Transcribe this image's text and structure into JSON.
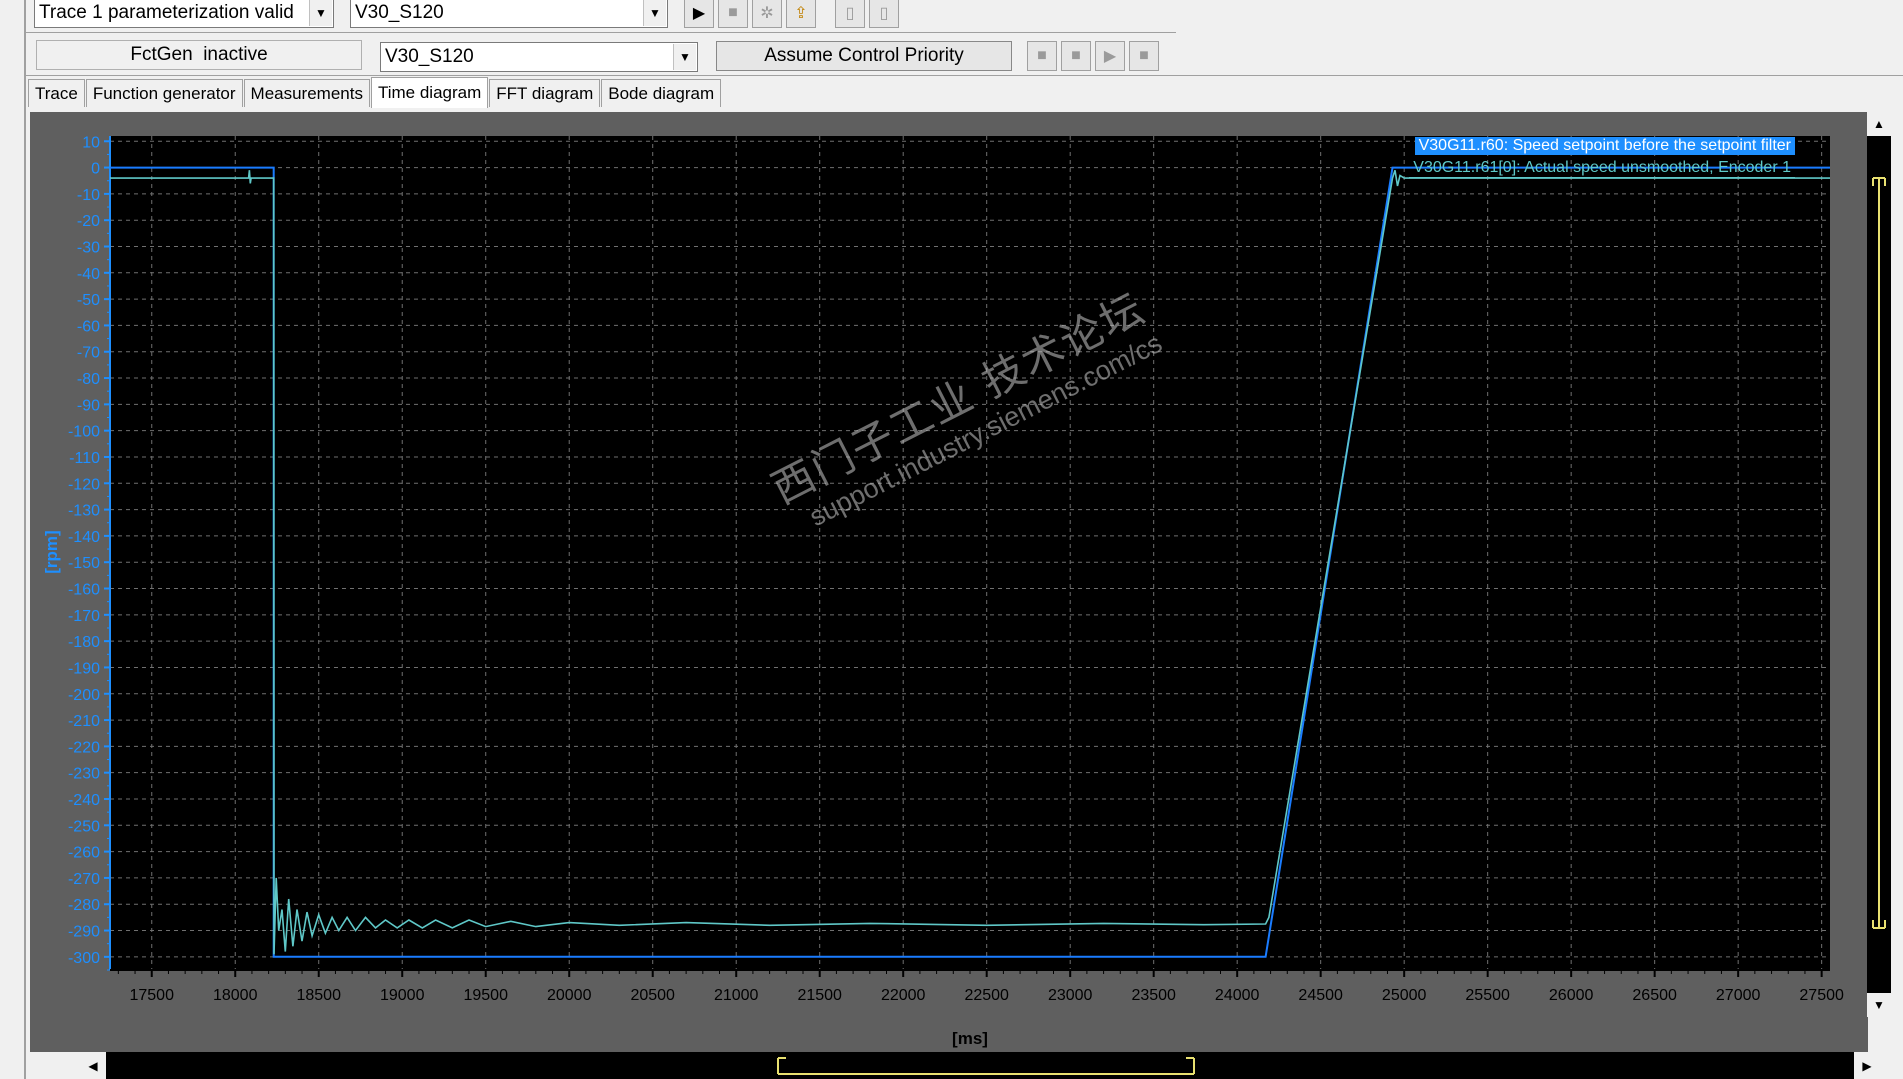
{
  "toolbar": {
    "trace_status": "Trace 1 parameterization valid",
    "device_select_1": "V30_S120",
    "fctgen_status": "FctGen  inactive",
    "device_select_2": "V30_S120",
    "assume_control_priority_label": "Assume Control Priority"
  },
  "tabs": [
    {
      "label": "Trace"
    },
    {
      "label": "Function generator"
    },
    {
      "label": "Measurements"
    },
    {
      "label": "Time diagram"
    },
    {
      "label": "FFT diagram"
    },
    {
      "label": "Bode diagram"
    }
  ],
  "active_tab": "Time diagram",
  "watermark": {
    "line1": "西门子工业  技术论坛",
    "line2": "support.industry.siemens.com/cs"
  },
  "colors": {
    "plot_background": "#000000",
    "panel_background": "#5f5f5f",
    "axis_color": "#1e8fff",
    "setpoint_color": "#1a7cff",
    "actual_color": "#5fc8c8",
    "grid_color": "#707070",
    "legend_highlight": "#1e8fff"
  },
  "chart_data": {
    "type": "line",
    "title": "",
    "xlabel": "[ms]",
    "ylabel": "[rpm]",
    "xlim": [
      17250,
      27550
    ],
    "ylim": [
      -305,
      12
    ],
    "x_ticks": [
      17500,
      18000,
      18500,
      19000,
      19500,
      20000,
      20500,
      21000,
      21500,
      22000,
      22500,
      23000,
      23500,
      24000,
      24500,
      25000,
      25500,
      26000,
      26500,
      27000,
      27500
    ],
    "y_ticks": [
      10,
      0,
      -10,
      -20,
      -30,
      -40,
      -50,
      -60,
      -70,
      -80,
      -90,
      -100,
      -110,
      -120,
      -130,
      -140,
      -150,
      -160,
      -170,
      -180,
      -190,
      -200,
      -210,
      -220,
      -230,
      -240,
      -250,
      -260,
      -270,
      -280,
      -290,
      -300
    ],
    "grid": true,
    "legend_position": "top-right",
    "series": [
      {
        "name": "V30G11.r60: Speed setpoint before the setpoint filter",
        "color": "#1a7cff",
        "points": [
          [
            17250,
            0
          ],
          [
            18230,
            0
          ],
          [
            18230,
            -300
          ],
          [
            24170,
            -300
          ],
          [
            24930,
            0
          ],
          [
            27550,
            0
          ]
        ]
      },
      {
        "name": "V30G11.r61[0]: Actual speed unsmoothed, Encoder 1",
        "color": "#5fc8c8",
        "points": [
          [
            17250,
            -4
          ],
          [
            18080,
            -4
          ],
          [
            18085,
            -1
          ],
          [
            18090,
            -6
          ],
          [
            18095,
            -4
          ],
          [
            18230,
            -4
          ],
          [
            18232,
            -299
          ],
          [
            18245,
            -270
          ],
          [
            18260,
            -290
          ],
          [
            18280,
            -282
          ],
          [
            18300,
            -298
          ],
          [
            18320,
            -278
          ],
          [
            18345,
            -296
          ],
          [
            18370,
            -282
          ],
          [
            18400,
            -294
          ],
          [
            18430,
            -283
          ],
          [
            18460,
            -292
          ],
          [
            18500,
            -284
          ],
          [
            18540,
            -291
          ],
          [
            18580,
            -285
          ],
          [
            18620,
            -290
          ],
          [
            18670,
            -285
          ],
          [
            18720,
            -290
          ],
          [
            18780,
            -285
          ],
          [
            18840,
            -289
          ],
          [
            18900,
            -286
          ],
          [
            18970,
            -289
          ],
          [
            19040,
            -286
          ],
          [
            19120,
            -289
          ],
          [
            19200,
            -286
          ],
          [
            19300,
            -289
          ],
          [
            19400,
            -286
          ],
          [
            19500,
            -288.5
          ],
          [
            19650,
            -286.5
          ],
          [
            19800,
            -288.5
          ],
          [
            20000,
            -287
          ],
          [
            20300,
            -288
          ],
          [
            20700,
            -287
          ],
          [
            21200,
            -288
          ],
          [
            21800,
            -287.3
          ],
          [
            22500,
            -288
          ],
          [
            23200,
            -287.3
          ],
          [
            23800,
            -287.8
          ],
          [
            24170,
            -287.5
          ],
          [
            24190,
            -285
          ],
          [
            24930,
            -4
          ],
          [
            24945,
            -1
          ],
          [
            24960,
            -7
          ],
          [
            24975,
            -3
          ],
          [
            25000,
            -4
          ],
          [
            27550,
            -4
          ]
        ]
      }
    ]
  }
}
